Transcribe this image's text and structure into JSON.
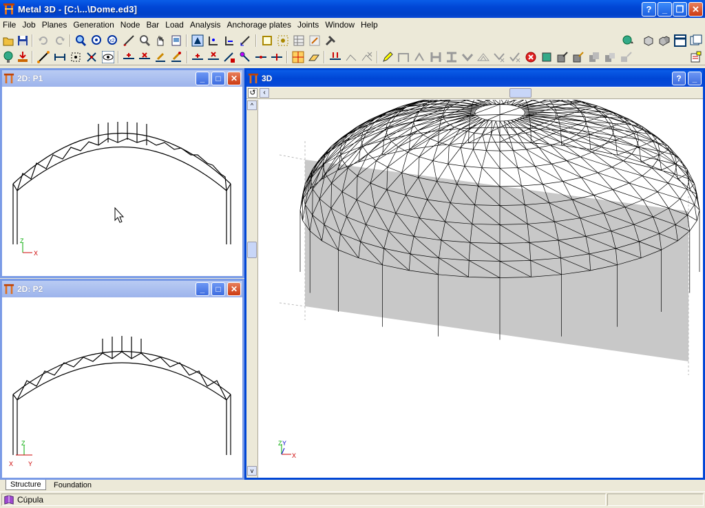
{
  "window": {
    "title": "Metal 3D - [C:\\...\\Dome.ed3]"
  },
  "menu": [
    "File",
    "Job",
    "Planes",
    "Generation",
    "Node",
    "Bar",
    "Load",
    "Analysis",
    "Anchorage plates",
    "Joints",
    "Window",
    "Help"
  ],
  "panels": {
    "p1": {
      "title": "2D: P1",
      "axis_v": "Z",
      "axis_h": "X"
    },
    "p2": {
      "title": "2D: P2",
      "axis_v": "Z",
      "axis_h_left": "X",
      "axis_h_right": "Y"
    },
    "view3d": {
      "title": "3D",
      "axis_v": "Z",
      "axis_v2": "Y",
      "axis_h": "X"
    }
  },
  "tabs": [
    "Structure",
    "Foundation"
  ],
  "status": {
    "text": "Cúpula"
  },
  "icons": {
    "app": "steel-beam-icon",
    "help": "help-icon",
    "minimize": "minimize-icon",
    "maximize": "maximize-icon",
    "close": "close-icon",
    "rotate": "rotate-view-icon",
    "status": "book-icon"
  },
  "colors": {
    "accent": "#0046d5",
    "face": "#ece9d8",
    "plane": "#c8c8c8"
  }
}
